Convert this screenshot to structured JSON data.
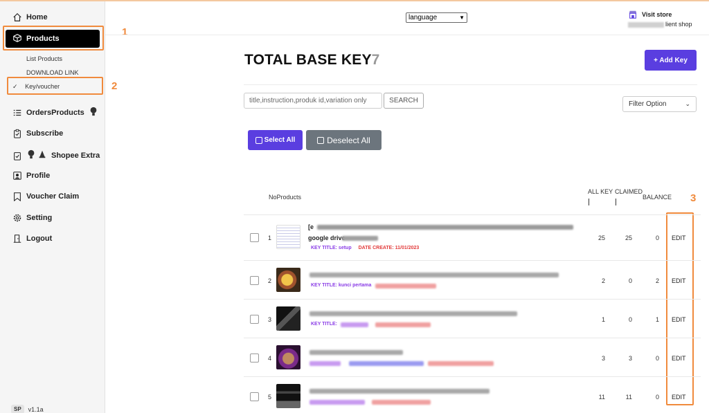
{
  "sidebar": {
    "home": "Home",
    "products": "Products",
    "list_products": "List Products",
    "download_link": "DOWNLOAD LINK",
    "key_voucher": "Key/voucher",
    "orders_products": "OrdersProducts",
    "subscribe": "Subscribe",
    "shopee_extra": "Shopee Extra",
    "profile": "Profile",
    "voucher_claim": "Voucher Claim",
    "setting": "Setting",
    "logout": "Logout",
    "avatar_initials": "SP",
    "version": "v1.1a"
  },
  "annotations": {
    "n1": "1",
    "n2": "2",
    "n3": "3",
    "color": "#f08a3c"
  },
  "header": {
    "language": "language",
    "visit_store": "Visit store",
    "shop_name_suffix": "lient shop"
  },
  "main": {
    "title": "TOTAL BASE KEY",
    "title_count": "7",
    "add_key": "+ Add Key",
    "search_placeholder": "title,instruction,produk id,variation only",
    "search_button": "SEARCH",
    "filter": "Filter Option",
    "select_all": "Select All",
    "deselect_all": "Deselect All",
    "accent": "#5a3ee0"
  },
  "table": {
    "headers": {
      "no_products": "NoProducts",
      "all_key": "ALL KEY",
      "claimed": "CLAIMED",
      "balance": "BALANCE"
    },
    "edit_label": "EDIT",
    "rows": [
      {
        "no": "1",
        "title_prefix": "[e",
        "title_line2": "google drive",
        "key_title": "KEY TITLE: setup",
        "date_create": "DATE CREATE: 11/01/2023",
        "all_key": "25",
        "claimed": "25",
        "balance": "0"
      },
      {
        "no": "2",
        "key_title": "KEY TITLE: kunci pertama",
        "all_key": "2",
        "claimed": "0",
        "balance": "2"
      },
      {
        "no": "3",
        "key_title": "KEY TITLE:",
        "all_key": "1",
        "claimed": "0",
        "balance": "1"
      },
      {
        "no": "4",
        "all_key": "3",
        "claimed": "3",
        "balance": "0"
      },
      {
        "no": "5",
        "all_key": "11",
        "claimed": "11",
        "balance": "0"
      }
    ]
  }
}
